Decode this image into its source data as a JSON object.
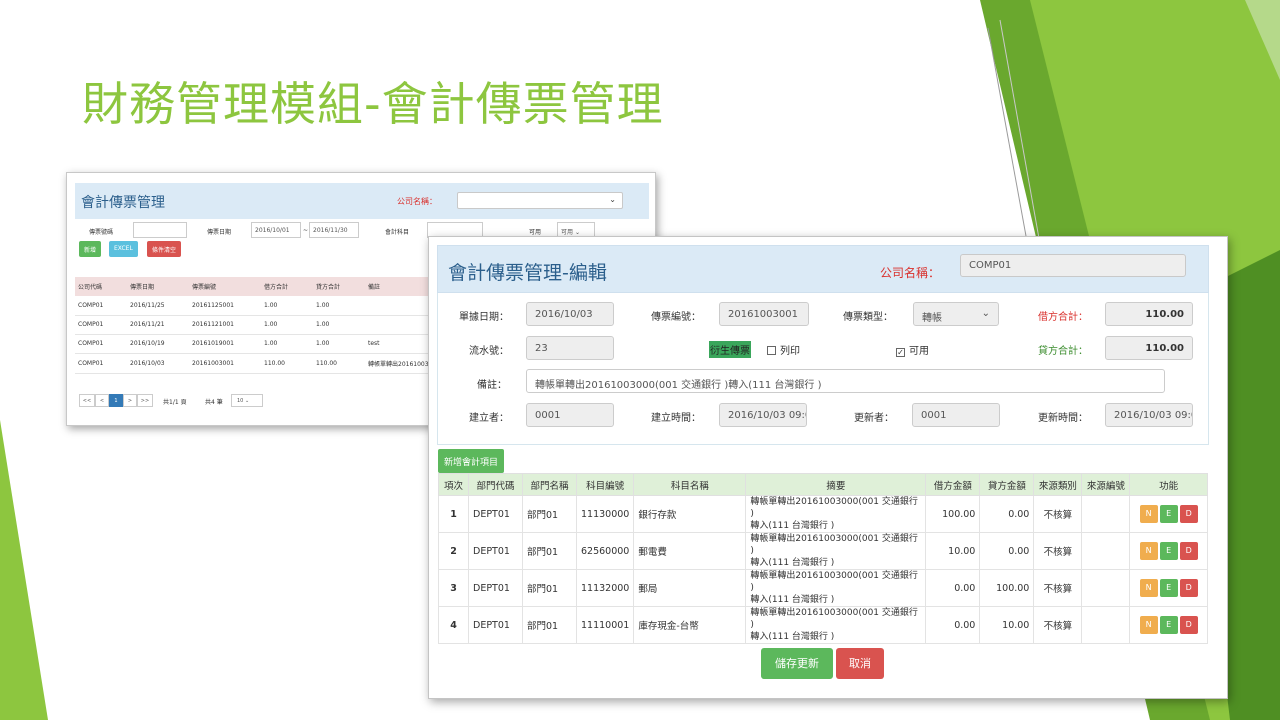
{
  "slide": {
    "title": "財務管理模組-會計傳票管理",
    "accent_color": "#8dc63f"
  },
  "back_window": {
    "title": "會計傳票管理",
    "company_label": "公司名稱：",
    "filters": {
      "voucher_no_label": "傳票號碼",
      "voucher_date_label": "傳票日期",
      "date_from": "2016/10/01",
      "date_sep": "~",
      "date_to": "2016/11/30",
      "account_label": "會計科目",
      "available_label": "可用",
      "available_value": "可用"
    },
    "buttons": {
      "add": "新增",
      "excel": "EXCEL",
      "reset": "條件清空"
    },
    "table": {
      "headers": [
        "公司代碼",
        "傳票日期",
        "傳票編號",
        "借方合計",
        "貸方合計",
        "備註"
      ],
      "rows": [
        [
          "COMP01",
          "2016/11/25",
          "20161125001",
          "1.00",
          "1.00",
          ""
        ],
        [
          "COMP01",
          "2016/11/21",
          "20161121001",
          "1.00",
          "1.00",
          ""
        ],
        [
          "COMP01",
          "2016/10/19",
          "20161019001",
          "1.00",
          "1.00",
          "test"
        ],
        [
          "COMP01",
          "2016/10/03",
          "20161003001",
          "110.00",
          "110.00",
          "轉帳單轉出20161003"
        ]
      ]
    },
    "pager": {
      "first": "<<",
      "prev": "<",
      "current": "1",
      "next": ">",
      "last": ">>",
      "page_info": "共1/1 頁",
      "total_info": "共4 筆",
      "page_size": "10"
    }
  },
  "front_window": {
    "title": "會計傳票管理-編輯",
    "company_label": "公司名稱：",
    "company_value": "COMP01",
    "form": {
      "doc_date_label": "單據日期：",
      "doc_date": "2016/10/03",
      "voucher_no_label": "傳票編號：",
      "voucher_no": "20161003001",
      "voucher_type_label": "傳票類型：",
      "voucher_type": "轉帳",
      "debit_total_label": "借方合計：",
      "debit_total": "110.00",
      "serial_label": "流水號：",
      "serial": "23",
      "generated_label": "衍生傳票",
      "print_label": "列印",
      "print_checked": false,
      "available_label": "可用",
      "available_checked": true,
      "credit_total_label": "貸方合計：",
      "credit_total": "110.00",
      "remark_label": "備註：",
      "remark": "轉帳單轉出20161003000(001 交通銀行 )轉入(111 台灣銀行 )",
      "creator_label": "建立者：",
      "creator": "0001",
      "created_time_label": "建立時間：",
      "created_time": "2016/10/03 09:0",
      "updater_label": "更新者：",
      "updater": "0001",
      "updated_time_label": "更新時間：",
      "updated_time": "2016/10/03 09:0"
    },
    "add_item_button": "新增會計項目",
    "grid": {
      "headers": [
        "項次",
        "部門代碼",
        "部門名稱",
        "科目編號",
        "科目名稱",
        "摘要",
        "借方金額",
        "貸方金額",
        "來源類別",
        "來源編號",
        "功能"
      ],
      "rows": [
        {
          "no": "1",
          "dept_code": "DEPT01",
          "dept_name": "部門01",
          "acct_no": "11130000",
          "acct_name": "銀行存款",
          "summary_1": "轉帳單轉出20161003000(001 交通銀行 )",
          "summary_2": "轉入(111 台灣銀行 )",
          "debit": "100.00",
          "credit": "0.00",
          "src_type": "不核算",
          "src_no": ""
        },
        {
          "no": "2",
          "dept_code": "DEPT01",
          "dept_name": "部門01",
          "acct_no": "62560000",
          "acct_name": "郵電費",
          "summary_1": "轉帳單轉出20161003000(001 交通銀行 )",
          "summary_2": "轉入(111 台灣銀行 )",
          "debit": "10.00",
          "credit": "0.00",
          "src_type": "不核算",
          "src_no": ""
        },
        {
          "no": "3",
          "dept_code": "DEPT01",
          "dept_name": "部門01",
          "acct_no": "11132000",
          "acct_name": "郵局",
          "summary_1": "轉帳單轉出20161003000(001 交通銀行 )",
          "summary_2": "轉入(111 台灣銀行 )",
          "debit": "0.00",
          "credit": "100.00",
          "src_type": "不核算",
          "src_no": ""
        },
        {
          "no": "4",
          "dept_code": "DEPT01",
          "dept_name": "部門01",
          "acct_no": "11110001",
          "acct_name": "庫存現金-台幣",
          "summary_1": "轉帳單轉出20161003000(001 交通銀行 )",
          "summary_2": "轉入(111 台灣銀行 )",
          "debit": "0.00",
          "credit": "10.00",
          "src_type": "不核算",
          "src_no": ""
        }
      ],
      "action_labels": {
        "n": "N",
        "e": "E",
        "d": "D"
      }
    },
    "save_button": "儲存更新",
    "cancel_button": "取消"
  }
}
